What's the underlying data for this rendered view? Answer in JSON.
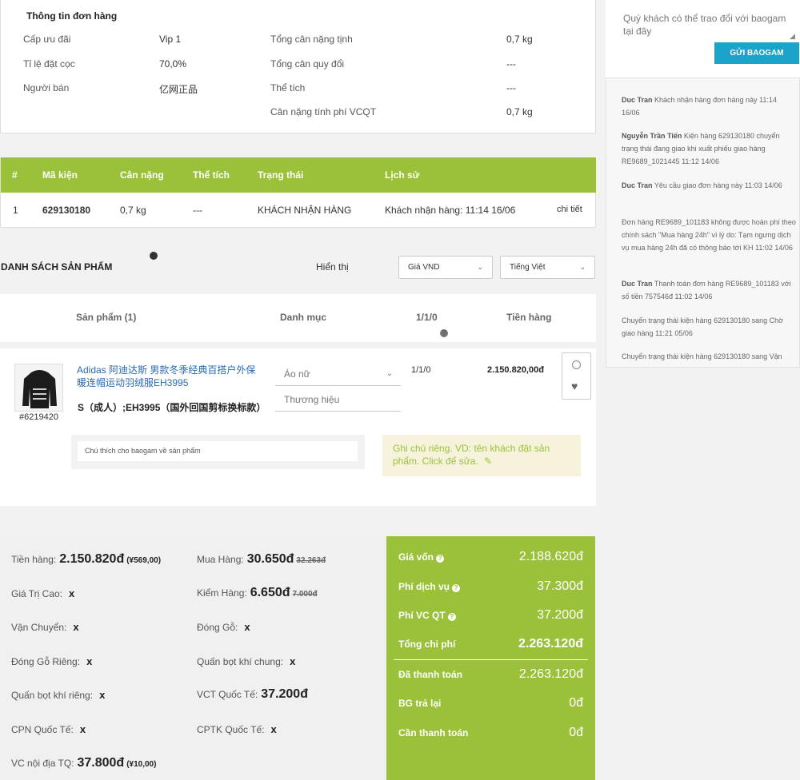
{
  "order_info": {
    "title": "Thông tin đơn hàng",
    "rows_left": [
      {
        "label": "Cấp ưu đãi",
        "value": "Vip 1"
      },
      {
        "label": "Tỉ lệ đặt cọc",
        "value": "70,0%"
      },
      {
        "label": "Người bán",
        "value": "亿网正品"
      }
    ],
    "rows_right": [
      {
        "label": "Tổng cân nặng tịnh",
        "value": "0,7 kg"
      },
      {
        "label": "Tổng cân quy đổi",
        "value": "---"
      },
      {
        "label": "Thể tích",
        "value": "---"
      },
      {
        "label": "Cân nặng tính phí VCQT",
        "value": "0,7 kg"
      }
    ]
  },
  "packages": {
    "headers": [
      "#",
      "Mã kiện",
      "Cân nặng",
      "Thể tích",
      "Trạng thái",
      "Lịch sử"
    ],
    "row": {
      "index": "1",
      "code": "629130180",
      "weight": "0,7 kg",
      "volume": "---",
      "status": "KHÁCH NHẬN HÀNG",
      "history": "Khách nhận hàng: 11:14 16/06",
      "detail_link": "chi tiết"
    }
  },
  "product_list": {
    "title": "DANH SÁCH SẢN PHẨM",
    "display_label": "Hiển thị",
    "currency_select": "Giá VND",
    "language_select": "Tiếng Việt",
    "headers": {
      "product": "Sản phẩm (1)",
      "category": "Danh mục",
      "ratio": "1/1/0",
      "amount": "Tiền hàng"
    },
    "item": {
      "sku": "#6219420",
      "name": "Adidas 阿迪达斯 男款冬季经典百搭户外保暖连帽运动羽绒服EH3995",
      "variant": "S（成人）;EH3995（国外回国剪标换标款）",
      "category": "Áo nữ",
      "brand_placeholder": "Thương hiệu",
      "ratio": "1/1/0",
      "amount": "2.150.820,00đ",
      "note_placeholder": "Chú thích cho baogam về sản phẩm",
      "private_note": "Ghi chú riêng. VD: tên khách đặt sản phẩm. Click để sửa."
    }
  },
  "summary_left": {
    "tien_hang": {
      "label": "Tiền hàng:",
      "value": "2.150.820đ",
      "sub": "(¥569,00)"
    },
    "mua_hang": {
      "label": "Mua Hàng:",
      "value": "30.650đ",
      "old": "32.263đ"
    },
    "gia_tri_cao": {
      "label": "Giá Trị Cao:",
      "value": "x"
    },
    "kiem_hang": {
      "label": "Kiểm Hàng:",
      "value": "6.650đ",
      "old": "7.000đ"
    },
    "van_chuyen": {
      "label": "Vận Chuyển:",
      "value": "x"
    },
    "dong_go": {
      "label": "Đóng Gỗ:",
      "value": "x"
    },
    "dong_go_rieng": {
      "label": "Đóng Gỗ Riêng:",
      "value": "x"
    },
    "quan_bot_chung": {
      "label": "Quấn bọt khí chung:",
      "value": "x"
    },
    "quan_bot_rieng": {
      "label": "Quấn bọt khí riêng:",
      "value": "x"
    },
    "vct_quoc_te": {
      "label": "VCT Quốc Tế:",
      "value": "37.200đ"
    },
    "cpn_quoc_te": {
      "label": "CPN Quốc Tế:",
      "value": "x"
    },
    "cptk_quoc_te": {
      "label": "CPTK Quốc Tế:",
      "value": "x"
    },
    "vc_noi_dia": {
      "label": "VC nội địa TQ:",
      "value": "37.800đ",
      "sub": "(¥10,00)"
    }
  },
  "summary_right": {
    "gia_von": {
      "label": "Giá vốn",
      "value": "2.188.620đ"
    },
    "phi_dich_vu": {
      "label": "Phí dịch vụ",
      "value": "37.300đ"
    },
    "phi_vc_qt": {
      "label": "Phí VC QT",
      "value": "37.200đ"
    },
    "tong_chi_phi": {
      "label": "Tổng chi phí",
      "value": "2.263.120đ"
    },
    "da_thanh_toan": {
      "label": "Đã thanh toán",
      "value": "2.263.120đ"
    },
    "bg_tra_lai": {
      "label": "BG trả lại",
      "value": "0đ"
    },
    "can_thanh_toan": {
      "label": "Cần thanh toán",
      "value": "0đ"
    }
  },
  "sidebar": {
    "message_placeholder": "Quý khách có thể trao đổi với baogam tại đây",
    "send_button": "GỬI BAOGAM",
    "history": [
      {
        "user": "Duc Tran",
        "text": "Khách nhận hàng đơn hàng này    11:14 16/06"
      },
      {
        "user": "Nguyễn Trần Tiến",
        "text": "Kiện hàng 629130180 chuyển trạng thái đang giao khi xuất phiếu giao hàng RE9689_1021445    11:12 14/06"
      },
      {
        "user": "Duc Tran",
        "text": "Yêu cầu giao đơn hàng này    11:03 14/06"
      },
      {
        "user": "",
        "text": "Đơn hàng RE9689_101183 không được hoàn phí theo chính sách \"Mua hàng 24h\" vì lý do: Tạm ngưng dịch vụ mua hàng 24h đã có thông báo tới KH    11:02 14/06"
      },
      {
        "user": "Duc Tran",
        "text": "Thanh toán đơn hàng RE9689_101183 với số tiền 757546đ    11:02 14/06"
      },
      {
        "user": "",
        "text": "Chuyển trạng thái kiện hàng 629130180 sang Chờ giao hàng    11:21 05/06"
      },
      {
        "user": "",
        "text": "Chuyển trạng thái kiện hàng 629130180 sang Vận"
      }
    ]
  },
  "colors": {
    "accent_green": "#9bc13b",
    "button_blue": "#1ba3c9",
    "link_blue": "#2a6ab0"
  }
}
